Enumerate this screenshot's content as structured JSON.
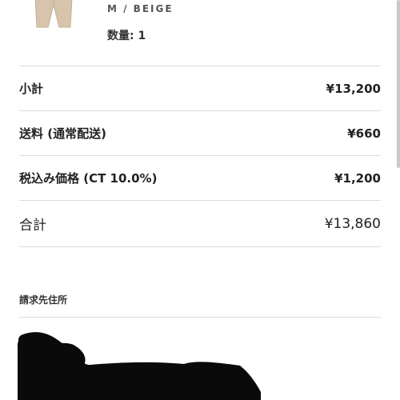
{
  "product": {
    "variant": "M / BEIGE",
    "quantity_label": "数量: 1",
    "thumbnail_icon": "beige-pants-thumbnail"
  },
  "summary": [
    {
      "label": "小計",
      "value": "¥13,200"
    },
    {
      "label": "送料 (通常配送)",
      "value": "¥660"
    },
    {
      "label": "税込み価格 (CT 10.0%)",
      "value": "¥1,200"
    },
    {
      "label": "合計",
      "value": "¥13,860"
    }
  ],
  "billing": {
    "title": "請求先住所"
  },
  "colors": {
    "divider": "#dcdcdc",
    "text": "#222222",
    "redaction": "#000000"
  }
}
